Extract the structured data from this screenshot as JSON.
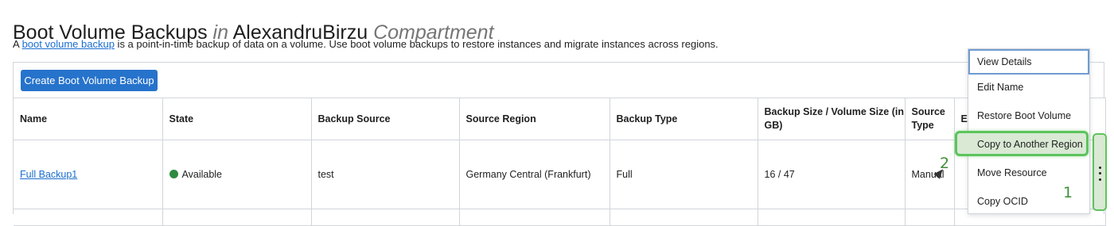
{
  "header": {
    "title_main": "Boot Volume Backups",
    "title_in": "in",
    "title_compartment": "AlexandruBirzu",
    "title_suffix": "Compartment"
  },
  "intro": {
    "prefix": "A ",
    "link": "boot volume backup",
    "rest": " is a point-in-time backup of data on a volume. Use boot volume backups to restore instances and migrate instances across regions."
  },
  "toolbar": {
    "create_label": "Create Boot Volume Backup"
  },
  "table": {
    "columns": {
      "name": "Name",
      "state": "State",
      "backup_source": "Backup Source",
      "source_region": "Source Region",
      "backup_type": "Backup Type",
      "size": "Backup Size / Volume Size (in GB)",
      "source_type": "Source Type",
      "expiration_partial": "E"
    },
    "rows": [
      {
        "name": "Full Backup1",
        "state": "Available",
        "backup_source": "test",
        "source_region": "Germany Central (Frankfurt)",
        "backup_type": "Full",
        "size": "16 / 47",
        "source_type": "Manual"
      }
    ]
  },
  "menu": {
    "items": [
      "View Details",
      "Edit Name",
      "Restore Boot Volume",
      "Copy to Another Region",
      "Move Resource",
      "Copy OCID"
    ]
  },
  "annotations": {
    "step1": "1",
    "step2": "2"
  },
  "colors": {
    "accent": "#2673cc",
    "highlight": "#5cc45c",
    "status_available": "#2e8b3e"
  },
  "icons": {
    "row_actions": "kebab-icon",
    "status": "status-dot-icon"
  }
}
